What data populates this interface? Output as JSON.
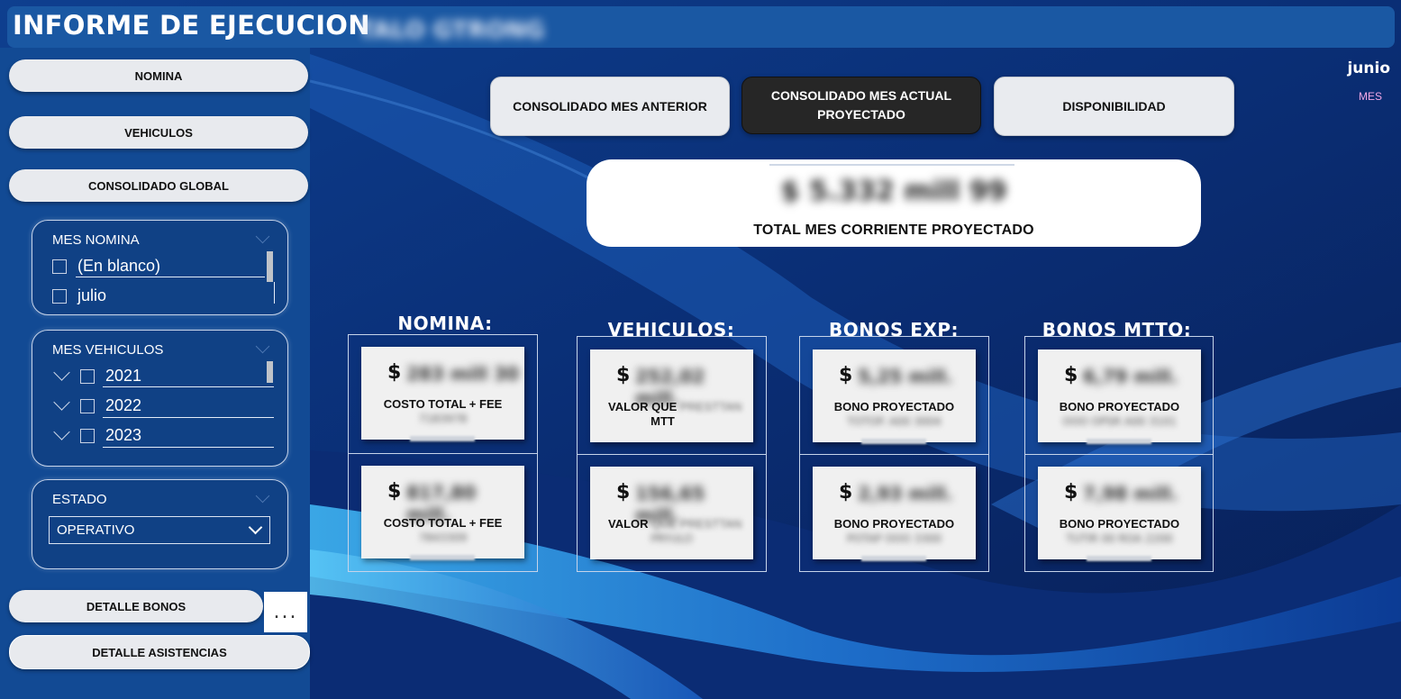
{
  "header": {
    "title": "INFORME DE EJECUCION",
    "subtitle_redacted": "TALO GTRONG"
  },
  "sidebar": {
    "nav_buttons": [
      "NOMINA",
      "VEHICULOS",
      "CONSOLIDADO GLOBAL"
    ],
    "slicer_mes_nomina": {
      "title": "MES NOMINA",
      "options": [
        "(En blanco)",
        "julio"
      ]
    },
    "slicer_mes_vehiculos": {
      "title": "MES VEHICULOS",
      "options": [
        "2021",
        "2022",
        "2023"
      ]
    },
    "slicer_estado": {
      "title": "ESTADO",
      "selected": "OPERATIVO"
    },
    "detail_buttons": [
      "DETALLE BONOS",
      "DETALLE ASISTENCIAS"
    ],
    "more_label": "..."
  },
  "tabs": [
    {
      "label": "CONSOLIDADO MES ANTERIOR",
      "active": false
    },
    {
      "label": "CONSOLIDADO MES ACTUAL PROYECTADO",
      "active": true
    },
    {
      "label": "DISPONIBILIDAD",
      "active": false
    }
  ],
  "month": {
    "value": "junio",
    "label": "MES"
  },
  "total": {
    "value_redacted": "$ 5.332 mill 99",
    "label": "TOTAL MES CORRIENTE PROYECTADO"
  },
  "groups": [
    {
      "title": "NOMINA:",
      "cards": [
        {
          "currency": "$",
          "value_redacted": "283 mill 30",
          "label": "COSTO TOTAL + FEE",
          "sub_redacted": "7183978"
        },
        {
          "currency": "$",
          "value_redacted": "817,80 mill.",
          "label": "COSTO TOTAL + FEE",
          "sub_redacted": "7843309"
        }
      ]
    },
    {
      "title": "VEHICULOS:",
      "cards": [
        {
          "currency": "$",
          "value_redacted": "252,02 mill.",
          "label": "VALOR QUE",
          "label_redacted": "PRESTTAN",
          "line2": "MTT",
          "sub_redacted": ""
        },
        {
          "currency": "$",
          "value_redacted": "156,65 mill.",
          "label": "VALOR",
          "label_redacted": "QUE PRESTTAN",
          "sub_redacted": "PRYULO"
        }
      ]
    },
    {
      "title": "BONOS EXP:",
      "cards": [
        {
          "currency": "$",
          "value_redacted": "5,25 mill.",
          "label": "BONO PROYECTADO",
          "sub_redacted": "TOTOP. A00 3004"
        },
        {
          "currency": "$",
          "value_redacted": "2,93 mill.",
          "label": "BONO PROYECTADO",
          "sub_redacted": "POTAP OOO 3300"
        }
      ]
    },
    {
      "title": "BONOS MTTO:",
      "cards": [
        {
          "currency": "$",
          "value_redacted": "6,79 mill.",
          "label": "BONO PROYECTADO",
          "sub_redacted": "OOO OPSR A00 3101"
        },
        {
          "currency": "$",
          "value_redacted": "7,98 mill.",
          "label": "BONO PROYECTADO",
          "sub_redacted": "TUTIR 00 ROA 2200"
        }
      ]
    }
  ],
  "colors": {
    "sidebar": "#124a94",
    "titlebar": "#1a58a3",
    "active_tab": "#262626",
    "month_label": "#f2a8e6"
  }
}
